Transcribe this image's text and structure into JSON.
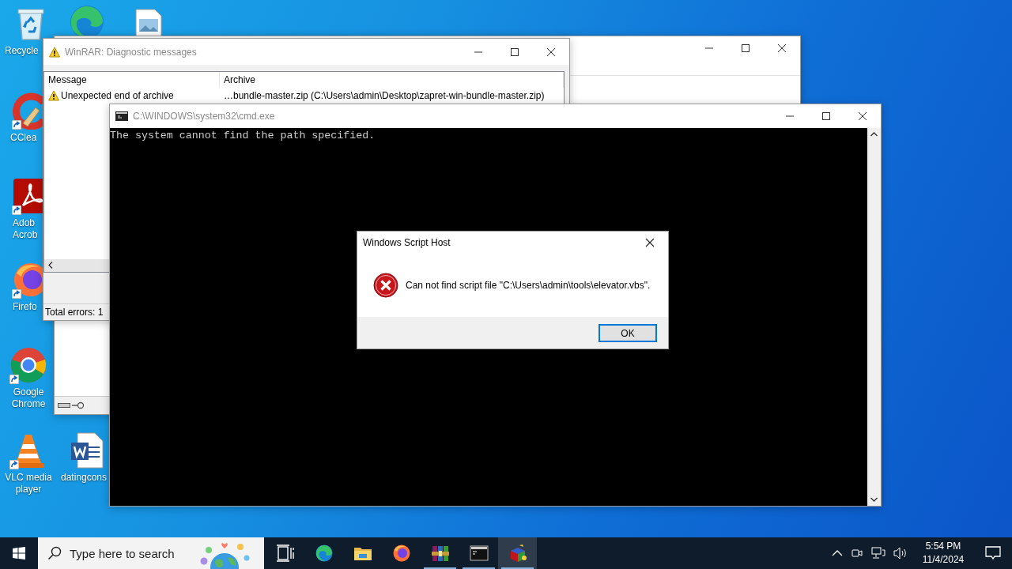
{
  "desktop": {
    "icons": [
      {
        "kind": "recycle-bin",
        "label_lines": [
          "Recycle"
        ],
        "shortcut": false
      },
      {
        "kind": "edge",
        "shortcut": false
      },
      {
        "kind": "image-file",
        "shortcut": false
      },
      {
        "kind": "ccleaner",
        "label_lines": [
          "CClea"
        ],
        "shortcut": true
      },
      {
        "kind": "acrobat",
        "label_lines": [
          "Adob",
          "Acrob"
        ],
        "shortcut": true
      },
      {
        "kind": "firefox",
        "label_lines": [
          "Firefo"
        ],
        "shortcut": true
      },
      {
        "kind": "chrome",
        "label_lines": [
          "Google",
          "Chrome"
        ],
        "shortcut": true
      },
      {
        "kind": "vlc",
        "label_lines": [
          "VLC media",
          "player"
        ],
        "shortcut": true
      },
      {
        "kind": "word",
        "label_lines": [
          "datingcons"
        ],
        "shortcut": false
      }
    ]
  },
  "windows": [
    {
      "kind": "plain"
    },
    {
      "kind": "diagnostics",
      "active": false,
      "title": "WinRAR: Diagnostic messages",
      "columns": [
        "Message",
        "Archive"
      ],
      "rows": [
        {
          "message": "Unexpected end of archive",
          "archive": "…bundle-master.zip (C:\\Users\\admin\\Desktop\\zapret-win-bundle-master.zip)"
        }
      ],
      "status": "Total errors: 1"
    },
    {
      "kind": "console",
      "active": false,
      "title": "C:\\WINDOWS\\system32\\cmd.exe",
      "lines": [
        "The system cannot find the path specified."
      ]
    },
    {
      "kind": "message",
      "active": true,
      "title": "Windows Script Host",
      "message": "Can not find script file \"C:\\Users\\admin\\tools\\elevator.vbs\".",
      "buttons": [
        "OK"
      ]
    }
  ],
  "taskbar": {
    "search": {
      "placeholder": "Type here to search"
    },
    "apps": [
      {
        "kind": "task-view",
        "running": false,
        "selected": false
      },
      {
        "kind": "edge",
        "running": false,
        "selected": false
      },
      {
        "kind": "explorer",
        "running": false,
        "selected": false
      },
      {
        "kind": "firefox",
        "running": false,
        "selected": false
      },
      {
        "kind": "winrar",
        "running": true,
        "selected": false
      },
      {
        "kind": "console",
        "running": true,
        "selected": false
      },
      {
        "kind": "script-host",
        "running": true,
        "selected": true
      }
    ],
    "clock": {
      "time": "5:54 PM",
      "date": "11/4/2024"
    }
  }
}
